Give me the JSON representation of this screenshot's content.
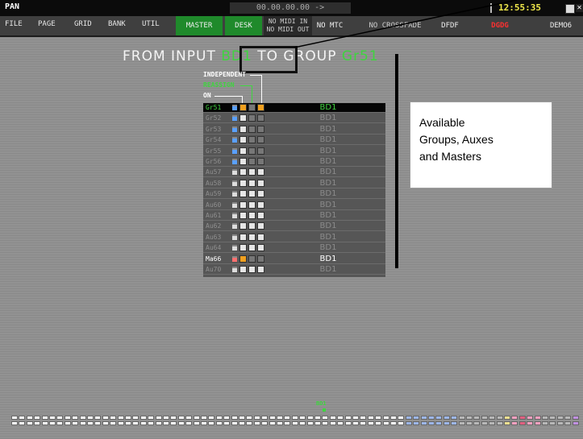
{
  "app": {
    "title": "PAN",
    "timecode": "00.00.00.00  ->",
    "clock": "12:55:35"
  },
  "menu": [
    "FILE",
    "PAGE",
    "GRID",
    "BANK",
    "UTIL"
  ],
  "toolbar": {
    "master": "MASTER",
    "desk": "DESK",
    "midi_in": "NO MIDI IN",
    "midi_out": "NO MIDI OUT",
    "mtc": "NO MTC",
    "crossfade": "NO CROSSFADE",
    "scene1": "DFDF",
    "scene2": "DGDG",
    "scene3": "DEMO6"
  },
  "heading": {
    "prefix": "FROM INPUT",
    "input": "BD1",
    "middle": "TO GROUP",
    "group": "Gr51"
  },
  "legend": {
    "independent": "INDEPENDENT",
    "reassign": "REASSIGN",
    "on": "ON"
  },
  "rows": [
    {
      "name": "Gr51",
      "source": "BD1",
      "state": "selected",
      "bar_color": "#5aa0ff",
      "squares": [
        "orange",
        "gray",
        "orange"
      ]
    },
    {
      "name": "Gr52",
      "source": "BD1",
      "state": "normal",
      "bar_color": "#5aa0ff",
      "squares": [
        "white",
        "gray",
        "gray"
      ]
    },
    {
      "name": "Gr53",
      "source": "BD1",
      "state": "normal",
      "bar_color": "#5aa0ff",
      "squares": [
        "white",
        "gray",
        "gray"
      ]
    },
    {
      "name": "Gr54",
      "source": "BD1",
      "state": "normal",
      "bar_color": "#5aa0ff",
      "squares": [
        "white",
        "gray",
        "gray"
      ]
    },
    {
      "name": "Gr55",
      "source": "BD1",
      "state": "normal",
      "bar_color": "#5aa0ff",
      "squares": [
        "white",
        "gray",
        "gray"
      ]
    },
    {
      "name": "Gr56",
      "source": "BD1",
      "state": "normal",
      "bar_color": "#5aa0ff",
      "squares": [
        "white",
        "gray",
        "gray"
      ]
    },
    {
      "name": "Au57",
      "source": "BD1",
      "state": "normal",
      "bar_color": "#dddddd",
      "squares": [
        "white",
        "white",
        "white"
      ]
    },
    {
      "name": "Au58",
      "source": "BD1",
      "state": "normal",
      "bar_color": "#dddddd",
      "squares": [
        "white",
        "white",
        "white"
      ]
    },
    {
      "name": "Au59",
      "source": "BD1",
      "state": "normal",
      "bar_color": "#dddddd",
      "squares": [
        "white",
        "white",
        "white"
      ]
    },
    {
      "name": "Au60",
      "source": "BD1",
      "state": "normal",
      "bar_color": "#dddddd",
      "squares": [
        "white",
        "white",
        "white"
      ]
    },
    {
      "name": "Au61",
      "source": "BD1",
      "state": "normal",
      "bar_color": "#dddddd",
      "squares": [
        "white",
        "white",
        "white"
      ]
    },
    {
      "name": "Au62",
      "source": "BD1",
      "state": "normal",
      "bar_color": "#dddddd",
      "squares": [
        "white",
        "white",
        "white"
      ]
    },
    {
      "name": "Au63",
      "source": "BD1",
      "state": "normal",
      "bar_color": "#dddddd",
      "squares": [
        "white",
        "white",
        "white"
      ]
    },
    {
      "name": "Au64",
      "source": "BD1",
      "state": "normal",
      "bar_color": "#dddddd",
      "squares": [
        "white",
        "white",
        "white"
      ]
    },
    {
      "name": "Ma66",
      "source": "BD1",
      "state": "highlight",
      "bar_color": "#ff7070",
      "squares": [
        "orange",
        "gray",
        "gray"
      ]
    },
    {
      "name": "Au70",
      "source": "BD1",
      "state": "normal",
      "bar_color": "#dddddd",
      "squares": [
        "white",
        "white",
        "white"
      ]
    }
  ],
  "annotation": {
    "line1": "Available",
    "line2": "Groups, Auxes",
    "line3": "and Masters"
  },
  "strip": {
    "label": "BD1"
  },
  "colors": {
    "accent_green": "#3fd43f",
    "menu_green": "#1f8a2b",
    "scene_red": "#ff3030",
    "clock_yellow": "#f0e84a"
  }
}
